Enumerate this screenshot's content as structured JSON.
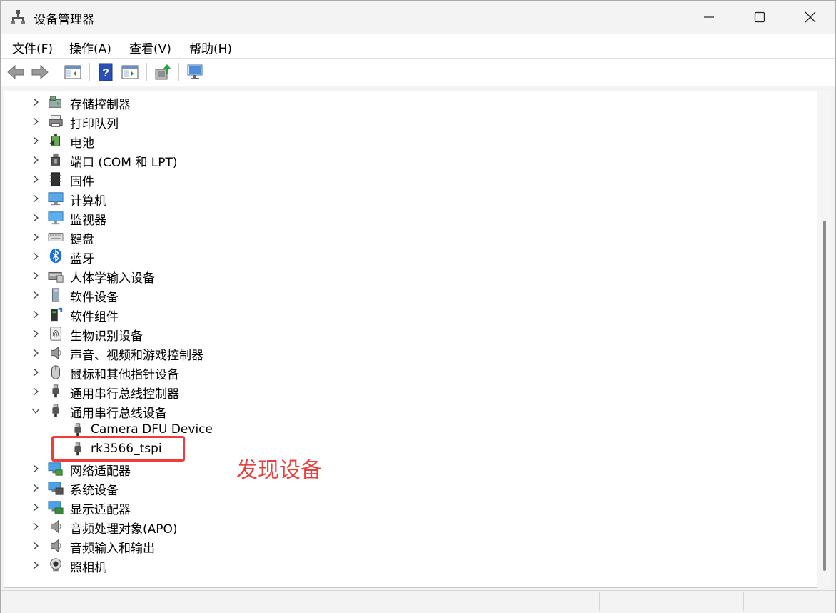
{
  "window": {
    "title": "设备管理器",
    "icons": {
      "app": "device-manager-icon",
      "minimize": "minimize-icon",
      "maximize": "maximize-icon",
      "close": "close-icon"
    }
  },
  "menu": [
    {
      "label": "文件(F)"
    },
    {
      "label": "操作(A)"
    },
    {
      "label": "查看(V)"
    },
    {
      "label": "帮助(H)"
    }
  ],
  "toolbar": [
    "back-arrow-icon",
    "forward-arrow-icon",
    "show-hide-console-tree-icon",
    "help-icon",
    "properties-icon",
    "update-driver-icon",
    "scan-hardware-icon"
  ],
  "tree": {
    "items": [
      {
        "label": "存储控制器",
        "icon": "storage-controller-icon",
        "expanded": false
      },
      {
        "label": "打印队列",
        "icon": "printer-icon",
        "expanded": false
      },
      {
        "label": "电池",
        "icon": "battery-icon",
        "expanded": false
      },
      {
        "label": "端口 (COM 和 LPT)",
        "icon": "port-icon",
        "expanded": false
      },
      {
        "label": "固件",
        "icon": "firmware-icon",
        "expanded": false
      },
      {
        "label": "计算机",
        "icon": "computer-icon",
        "expanded": false
      },
      {
        "label": "监视器",
        "icon": "monitor-icon",
        "expanded": false
      },
      {
        "label": "键盘",
        "icon": "keyboard-icon",
        "expanded": false
      },
      {
        "label": "蓝牙",
        "icon": "bluetooth-icon",
        "expanded": false
      },
      {
        "label": "人体学输入设备",
        "icon": "hid-icon",
        "expanded": false
      },
      {
        "label": "软件设备",
        "icon": "software-device-icon",
        "expanded": false
      },
      {
        "label": "软件组件",
        "icon": "software-component-icon",
        "expanded": false
      },
      {
        "label": "生物识别设备",
        "icon": "fingerprint-icon",
        "expanded": false
      },
      {
        "label": "声音、视频和游戏控制器",
        "icon": "speaker-icon",
        "expanded": false
      },
      {
        "label": "鼠标和其他指针设备",
        "icon": "mouse-icon",
        "expanded": false
      },
      {
        "label": "通用串行总线控制器",
        "icon": "usb-icon",
        "expanded": false
      },
      {
        "label": "通用串行总线设备",
        "icon": "usb-icon",
        "expanded": true
      },
      {
        "label": "Camera DFU Device",
        "icon": "usb-icon",
        "child": true
      },
      {
        "label": "rk3566_tspi",
        "icon": "usb-icon",
        "child": true
      },
      {
        "label": "网络适配器",
        "icon": "network-adapter-icon",
        "expanded": false
      },
      {
        "label": "系统设备",
        "icon": "system-device-icon",
        "expanded": false
      },
      {
        "label": "显示适配器",
        "icon": "display-adapter-icon",
        "expanded": false
      },
      {
        "label": "音频处理对象(APO)",
        "icon": "speaker-icon",
        "expanded": false
      },
      {
        "label": "音频输入和输出",
        "icon": "speaker-icon",
        "expanded": false
      },
      {
        "label": "照相机",
        "icon": "webcam-icon",
        "expanded": false
      }
    ]
  },
  "annotation": {
    "text": "发现设备",
    "color": "#e8403f"
  }
}
